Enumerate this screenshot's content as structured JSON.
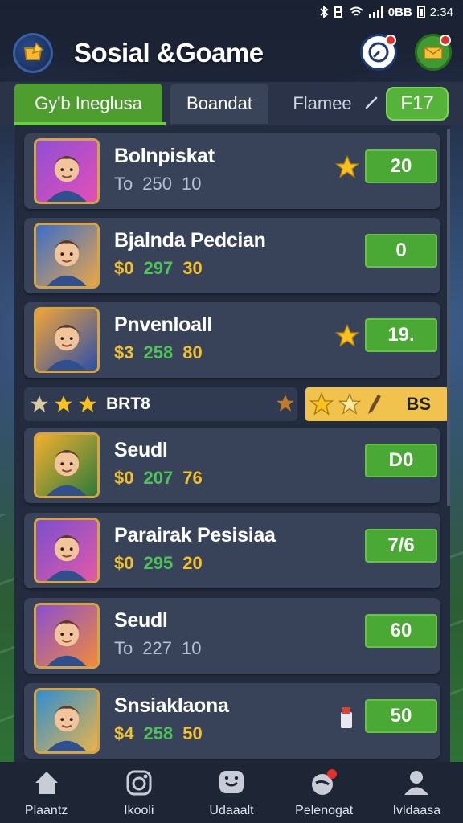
{
  "status_bar": {
    "time": "2:34",
    "battery_label": "0BB"
  },
  "header": {
    "title": "Sosial &Goame",
    "logo_icon": "trophy-icon",
    "bell_icon": "notification-icon",
    "message_icon": "message-icon"
  },
  "tabs": {
    "items": [
      {
        "label": "Gy'b Ineglusa"
      },
      {
        "label": "Boandat"
      },
      {
        "label": "Flamee"
      }
    ],
    "badge": "F17"
  },
  "leaderboard": [
    {
      "name": "Bolnpiskat",
      "stat_a": "To",
      "stat_b": "250",
      "stat_c": "10",
      "score": "20",
      "has_star": true,
      "colors": [
        "#8f4fd6",
        "#e24fb6"
      ]
    },
    {
      "name": "Bjalnda Pedcian",
      "stat_a": "$0",
      "stat_b": "297",
      "stat_c": "30",
      "score": "0",
      "has_star": false,
      "colors": [
        "#3a6ec8",
        "#e8a64a"
      ]
    },
    {
      "name": "Pnvenloall",
      "stat_a": "$3",
      "stat_b": "258",
      "stat_c": "80",
      "score": "19.",
      "has_star": true,
      "colors": [
        "#f0a43a",
        "#2b4fa8"
      ]
    },
    {
      "name": "Seudl",
      "stat_a": "$0",
      "stat_b": "207",
      "stat_c": "76",
      "score": "D0",
      "has_star": false,
      "colors": [
        "#f0b030",
        "#2e7a3a"
      ]
    },
    {
      "name": "Parairak Pesisiaa",
      "stat_a": "$0",
      "stat_b": "295",
      "stat_c": "20",
      "score": "7/6",
      "has_star": false,
      "colors": [
        "#7a4fd0",
        "#e15aa6"
      ]
    },
    {
      "name": "Seudl",
      "stat_a": "To",
      "stat_b": "227",
      "stat_c": "10",
      "score": "60",
      "has_star": false,
      "colors": [
        "#8a4fd2",
        "#f08a3a"
      ]
    },
    {
      "name": "Snsiaklaona",
      "stat_a": "$4",
      "stat_b": "258",
      "stat_c": "50",
      "score": "50",
      "has_star": false,
      "has_extra": true,
      "colors": [
        "#2f8ed0",
        "#e8b44a"
      ]
    }
  ],
  "rank_strip": {
    "label": "BRT8",
    "value": "BS"
  },
  "bottom_nav": [
    {
      "label": "Plaantz",
      "icon": "home-icon"
    },
    {
      "label": "Ikooli",
      "icon": "camera-icon"
    },
    {
      "label": "Udaaalt",
      "icon": "chat-icon"
    },
    {
      "label": "Pelenogat",
      "icon": "notification-icon"
    },
    {
      "label": "Ivldaasa",
      "icon": "profile-icon"
    }
  ]
}
